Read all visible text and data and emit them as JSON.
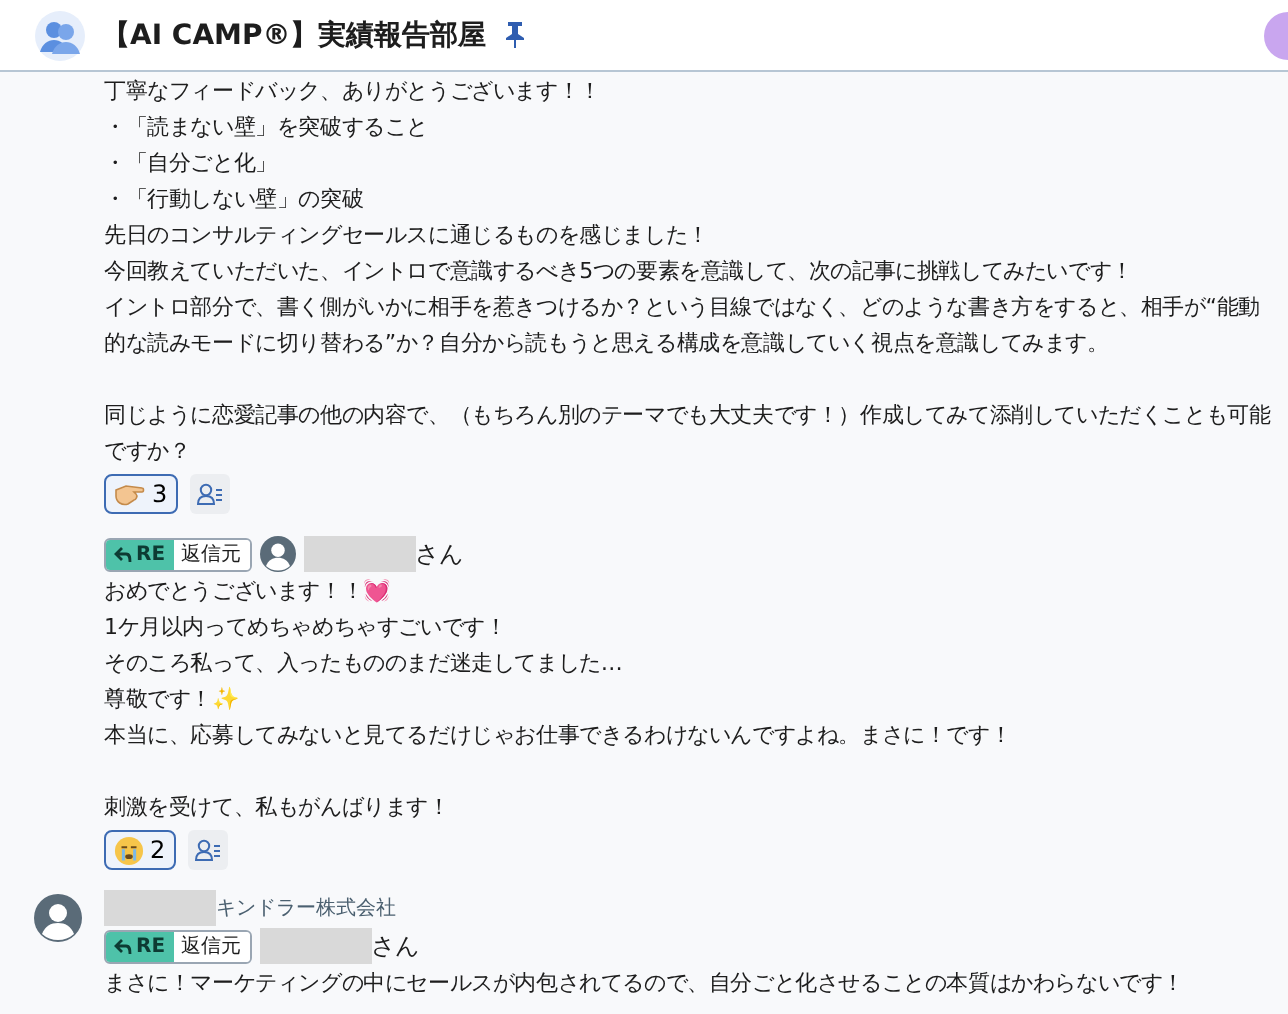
{
  "header": {
    "title": "【AI CAMP®】実績報告部屋"
  },
  "messages": [
    {
      "paragraphs": [
        [
          "丁寧なフィードバック、ありがとうございます！！",
          "・「読まない壁」を突破すること",
          "・「自分ごと化」",
          "・「行動しない壁」の突破",
          "先日のコンサルティングセールスに通じるものを感じました！",
          "今回教えていただいた、イントロで意識するべき5つの要素を意識して、次の記事に挑戦してみたいです！",
          "イントロ部分で、書く側がいかに相手を惹きつけるか？という目線ではなく、どのような書き方をすると、相手が“能動的な読みモードに切り替わる”か？自分から読もうと思える構成を意識していく視点を意識してみます。"
        ],
        [
          "同じように恋愛記事の他の内容で、（もちろん別のテーマでも大丈夫です！）作成してみて添削していただくことも可能ですか？"
        ]
      ],
      "reactions": [
        {
          "kind": "hand",
          "count": "3",
          "selected": true
        }
      ]
    },
    {
      "reply": {
        "re": "RE",
        "label": "返信元",
        "suffix": "さん"
      },
      "paragraphs": [
        [
          "おめでとうございます！！💓",
          "1ケ月以内ってめちゃめちゃすごいです！",
          "そのころ私って、入ったもののまだ迷走してました…",
          "尊敬です！✨",
          "本当に、応募してみないと見てるだけじゃお仕事できるわけないんですよね。まさに！です！"
        ],
        [
          "刺激を受けて、私もがんばります！"
        ]
      ],
      "reactions": [
        {
          "kind": "face",
          "count": "2",
          "selected": true
        }
      ]
    },
    {
      "author": {
        "company": "キンドラー株式会社"
      },
      "reply": {
        "re": "RE",
        "label": "返信元",
        "suffix": "さん"
      },
      "paragraphs": [
        [
          "まさに！マーケティングの中にセールスが内包されてるので、自分ごと化させることの本質はかわらないです！"
        ]
      ]
    }
  ]
}
